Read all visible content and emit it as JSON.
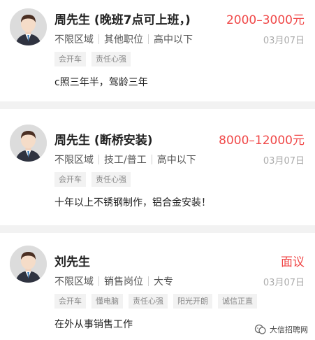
{
  "listings": [
    {
      "name": "周先生 (晚班7点可上班，)",
      "salary": "2000–3000元",
      "meta": [
        "不限区域",
        "其他职位",
        "高中以下"
      ],
      "date": "03月07日",
      "tags": [
        "会开车",
        "责任心强"
      ],
      "desc": "c照三年半，驾龄三年"
    },
    {
      "name": "周先生 (断桥安装)",
      "salary": "8000–12000元",
      "meta": [
        "不限区域",
        "技工/普工",
        "高中以下"
      ],
      "date": "03月07日",
      "tags": [
        "会开车",
        "责任心强"
      ],
      "desc": "十年以上不锈钢制作，铝合金安装！"
    },
    {
      "name": "刘先生",
      "salary": "面议",
      "meta": [
        "不限区域",
        "销售岗位",
        "大专"
      ],
      "date": "03月07日",
      "tags": [
        "会开车",
        "懂电脑",
        "责任心强",
        "阳光开朗",
        "诚信正直"
      ],
      "desc": "在外从事销售工作"
    }
  ],
  "watermark": "大信招聘网",
  "colors": {
    "salary": "#f04848",
    "tag_bg": "#f2f2f2",
    "separator": "#f2f2f2"
  }
}
